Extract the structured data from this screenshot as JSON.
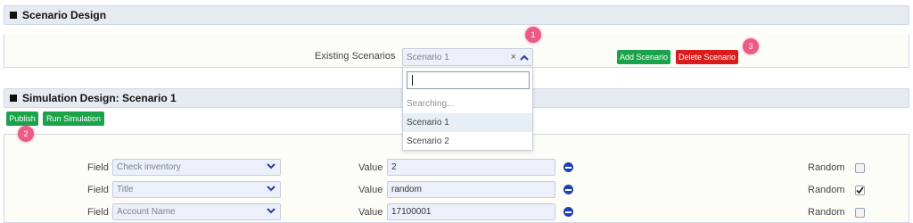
{
  "scenario_design": {
    "title": "Scenario Design",
    "existing_label": "Existing Scenarios",
    "selected_value": "Scenario 1",
    "clear_symbol": "×",
    "add_button": "Add Scenario",
    "delete_button": "Delete Scenario",
    "dropdown": {
      "search_value": "",
      "searching_text": "Searching...",
      "options": [
        "Scenario 1",
        "Scenario 2"
      ],
      "highlighted": "Scenario 1"
    }
  },
  "simulation_design": {
    "title": "Simulation Design: Scenario 1",
    "publish_button": "Publish",
    "run_button": "Run Simulation"
  },
  "badges": [
    "1",
    "2",
    "3"
  ],
  "rows": [
    {
      "field_label": "Field",
      "field_value": "Check inventory",
      "value_label": "Value",
      "value": "2",
      "random_label": "Random",
      "random_checked": false
    },
    {
      "field_label": "Field",
      "field_value": "Title",
      "value_label": "Value",
      "value": "random",
      "random_label": "Random",
      "random_checked": true
    },
    {
      "field_label": "Field",
      "field_value": "Account Name",
      "value_label": "Value",
      "value": "17100001",
      "random_label": "Random",
      "random_checked": false
    }
  ],
  "colors": {
    "header_bg": "#e6ebf2",
    "green_button": "#1aa34a",
    "red_button": "#d81b1b",
    "badge": "#ec5a86",
    "chevron": "#2d3aa8"
  }
}
